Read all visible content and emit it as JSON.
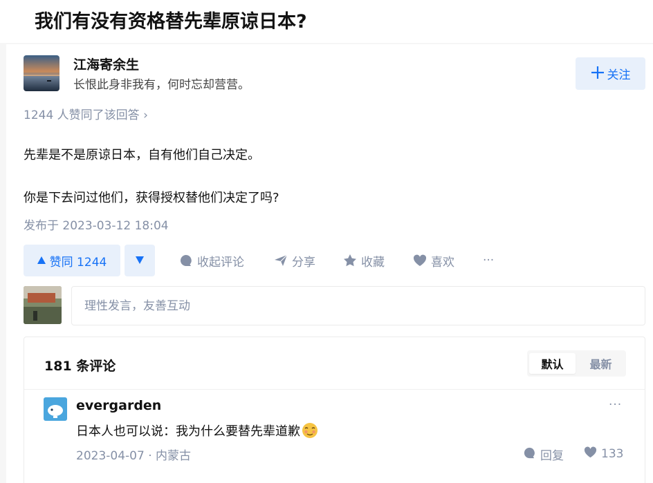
{
  "question": {
    "title": "我们有没有资格替先辈原谅日本?"
  },
  "author": {
    "name": "江海寄余生",
    "bio": "长恨此身非我有，何时忘却营营。"
  },
  "follow": {
    "label": "关注"
  },
  "answer": {
    "voters_text": "1244 人赞同了该回答 ›",
    "paragraphs": [
      "先辈是不是原谅日本，自有他们自己决定。",
      "你是下去问过他们，获得授权替他们决定了吗?"
    ],
    "published": "发布于 2023-03-12 18:04"
  },
  "actions": {
    "vote_up": "赞同 1244",
    "collapse_comments": "收起评论",
    "share": "分享",
    "collect": "收藏",
    "like": "喜欢",
    "more": "···"
  },
  "comment_input": {
    "placeholder": "理性发言，友善互动"
  },
  "comments": {
    "count_label": "181 条评论",
    "sort_default": "默认",
    "sort_latest": "最新",
    "items": [
      {
        "author": "evergarden",
        "text": "日本人也可以说：我为什么要替先辈道歉",
        "date": "2023-04-07",
        "location": "内蒙古",
        "meta": "2023-04-07 · 内蒙古",
        "reply_label": "回复",
        "likes": "133",
        "more": "···"
      }
    ]
  },
  "colors": {
    "accent": "#1772f6",
    "accent_bg": "#e8f0fb",
    "muted": "#8590a6",
    "text": "#121212"
  }
}
